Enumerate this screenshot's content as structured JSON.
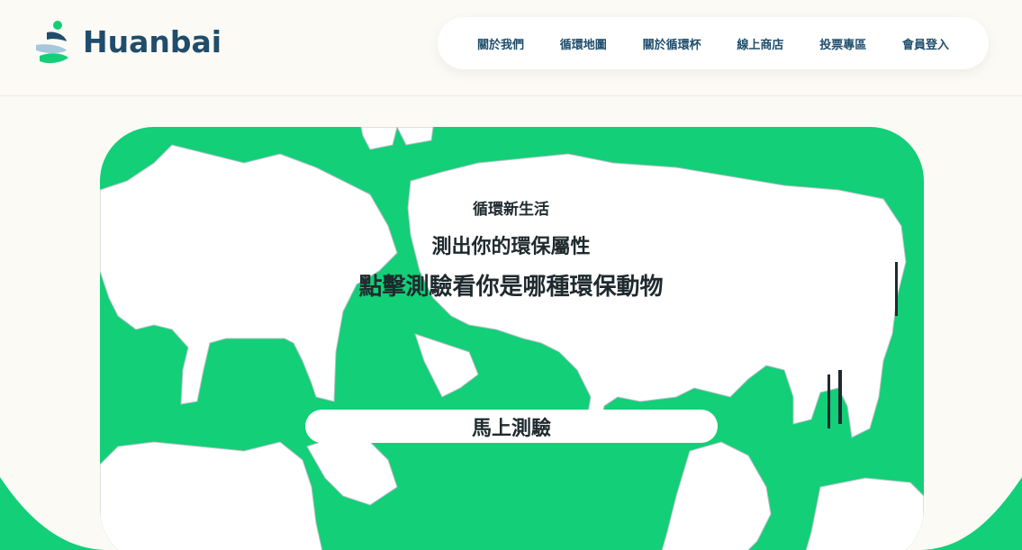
{
  "brand": {
    "name": "Huanbai"
  },
  "nav": {
    "items": [
      {
        "label": "關於我們"
      },
      {
        "label": "循環地圖"
      },
      {
        "label": "關於循環杯"
      },
      {
        "label": "線上商店"
      },
      {
        "label": "投票專區"
      },
      {
        "label": "會員登入"
      }
    ]
  },
  "hero": {
    "subtitle": "循環新生活",
    "headline": "測出你的環保屬性",
    "headline_2": "點擊測驗看你是哪種環保動物",
    "cta_label": "馬上測驗"
  },
  "colors": {
    "brand_green": "#12cf78",
    "brand_navy": "#1f4d6b",
    "background": "#fcfaf5"
  }
}
